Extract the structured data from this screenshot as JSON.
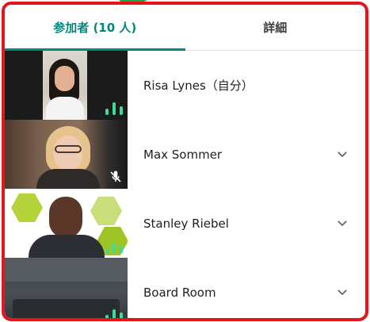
{
  "tabs": [
    {
      "label": "参加者 (10 人)",
      "active": true
    },
    {
      "label": "詳細",
      "active": false
    }
  ],
  "participants": [
    {
      "name": "Risa Lynes（自分）",
      "audio": "speaking"
    },
    {
      "name": "Max Sommer",
      "audio": "muted"
    },
    {
      "name": "Stanley Riebel",
      "audio": "speaking"
    },
    {
      "name": "Board Room",
      "audio": "speaking"
    }
  ],
  "colors": {
    "accent": "#00897b",
    "frame": "#e8141b",
    "callout": "#1fa64a",
    "audio": "#3ddc97"
  },
  "icons": {
    "expand": "chevron-down-icon",
    "audio": "audio-level-icon",
    "muted": "mic-off-icon"
  }
}
